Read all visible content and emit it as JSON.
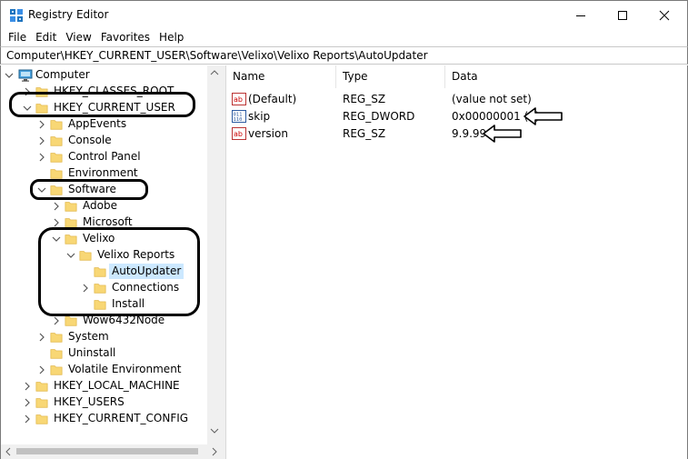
{
  "window": {
    "title": "Registry Editor"
  },
  "menu": [
    "File",
    "Edit",
    "View",
    "Favorites",
    "Help"
  ],
  "address": "Computer\\HKEY_CURRENT_USER\\Software\\Velixo\\Velixo Reports\\AutoUpdater",
  "tree": [
    {
      "label": "Computer",
      "level": 0,
      "expander": "expanded",
      "icon": "computer-icon"
    },
    {
      "label": "HKEY_CLASSES_ROOT",
      "level": 1,
      "expander": "collapsed"
    },
    {
      "label": "HKEY_CURRENT_USER",
      "level": 1,
      "expander": "expanded"
    },
    {
      "label": "AppEvents",
      "level": 2,
      "expander": "collapsed"
    },
    {
      "label": "Console",
      "level": 2,
      "expander": "collapsed"
    },
    {
      "label": "Control Panel",
      "level": 2,
      "expander": "collapsed"
    },
    {
      "label": "Environment",
      "level": 2,
      "expander": "none"
    },
    {
      "label": "Software",
      "level": 2,
      "expander": "expanded"
    },
    {
      "label": "Adobe",
      "level": 3,
      "expander": "collapsed"
    },
    {
      "label": "Microsoft",
      "level": 3,
      "expander": "collapsed"
    },
    {
      "label": "Velixo",
      "level": 3,
      "expander": "expanded"
    },
    {
      "label": "Velixo Reports",
      "level": 4,
      "expander": "expanded"
    },
    {
      "label": "AutoUpdater",
      "level": 5,
      "expander": "none",
      "selected": true
    },
    {
      "label": "Connections",
      "level": 5,
      "expander": "collapsed"
    },
    {
      "label": "Install",
      "level": 5,
      "expander": "none"
    },
    {
      "label": "Wow6432Node",
      "level": 3,
      "expander": "collapsed"
    },
    {
      "label": "System",
      "level": 2,
      "expander": "collapsed"
    },
    {
      "label": "Uninstall",
      "level": 2,
      "expander": "none"
    },
    {
      "label": "Volatile Environment",
      "level": 2,
      "expander": "collapsed"
    },
    {
      "label": "HKEY_LOCAL_MACHINE",
      "level": 1,
      "expander": "collapsed"
    },
    {
      "label": "HKEY_USERS",
      "level": 1,
      "expander": "collapsed"
    },
    {
      "label": "HKEY_CURRENT_CONFIG",
      "level": 1,
      "expander": "collapsed"
    }
  ],
  "columns": [
    "Name",
    "Type",
    "Data"
  ],
  "values": [
    {
      "name": "(Default)",
      "type": "REG_SZ",
      "data": "(value not set)",
      "icon": "string-value-icon"
    },
    {
      "name": "skip",
      "type": "REG_DWORD",
      "data": "0x00000001 (0)",
      "icon": "binary-value-icon"
    },
    {
      "name": "version",
      "type": "REG_SZ",
      "data": "9.9.99",
      "icon": "string-value-icon"
    }
  ],
  "colors": {
    "selection": "#cce8ff",
    "folder": "#f8d775",
    "folder_dark": "#e0b441"
  }
}
